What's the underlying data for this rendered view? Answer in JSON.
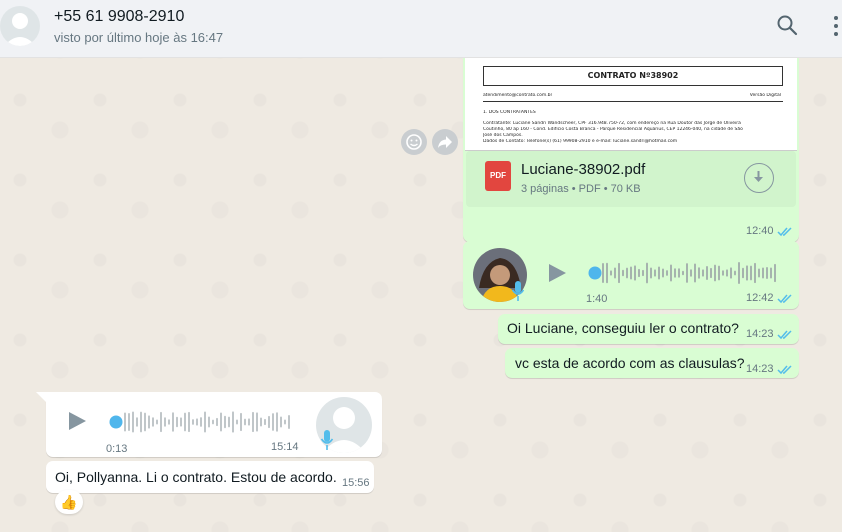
{
  "header": {
    "contact_name": "+55 61 9908-2910",
    "status": "visto por último hoje às 16:47",
    "search_icon": "search-icon",
    "menu_icon": "kebab-menu-icon"
  },
  "colors": {
    "outgoing_bubble": "#d9fdd3",
    "incoming_bubble": "#ffffff",
    "read_ticks": "#53bdeb",
    "pdf_red": "#e2463f"
  },
  "messages": [
    {
      "type": "document",
      "direction": "out",
      "preview": {
        "title": "CONTRATO Nº38902",
        "email_line": "atendimento@contrato.com.br",
        "version_label": "Versão Digital",
        "section": "1. DOS CONTRATANTES",
        "line1": "Contratante: Luciane Sandri Wandscheer, CPF 316.948.750-72, com endereço na Rua Doutor das Jorge de Oliveira",
        "line2": "Coutinho, 80 ap 160 - Cond. Edifício Costa Branca - Parque Residencial Aquarius, CEP 12246-040, na cidade de São",
        "line3": "José dos Campos.",
        "line4": "Dados de Contato: Telefone(s) (61) 99908-2910 e e-mail: luciane.sandri@hotmail.com"
      },
      "file_name": "Luciane-38902.pdf",
      "file_meta": "3 páginas • PDF • 70 KB",
      "file_badge": "PDF",
      "time": "12:40"
    },
    {
      "type": "audio",
      "direction": "out",
      "duration": "1:40",
      "time": "12:42"
    },
    {
      "type": "text",
      "direction": "out",
      "text": "Oi Luciane, conseguiu ler o contrato?",
      "time": "14:23"
    },
    {
      "type": "text",
      "direction": "out",
      "text": "vc esta de acordo com as clausulas?",
      "time": "14:23"
    },
    {
      "type": "audio",
      "direction": "in",
      "duration": "0:13",
      "time": "15:14"
    },
    {
      "type": "text",
      "direction": "in",
      "text": "Oi, Pollyanna. Li o contrato. Estou de acordo.",
      "time": "15:56",
      "reaction": "👍"
    }
  ]
}
